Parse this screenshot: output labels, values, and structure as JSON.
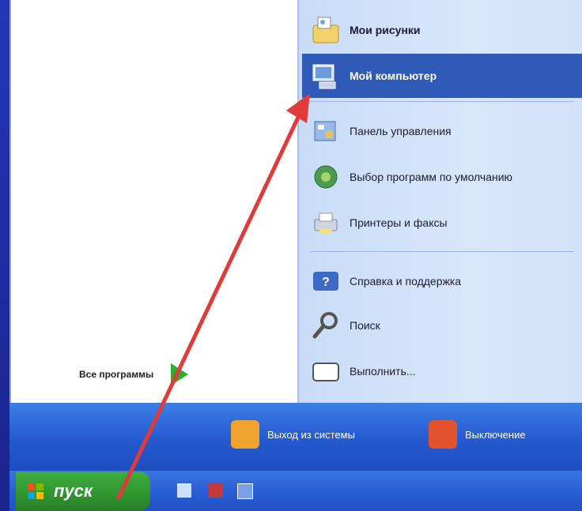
{
  "menu": {
    "right_items": [
      {
        "label": "Мои рисунки",
        "icon": "my-pictures-icon",
        "bold": true
      },
      {
        "label": "Мой компьютер",
        "icon": "my-computer-icon",
        "bold": true,
        "selected": true
      },
      {
        "label": "Панель управления",
        "icon": "control-panel-icon"
      },
      {
        "label": "Выбор программ по умолчанию",
        "icon": "default-programs-icon"
      },
      {
        "label": "Принтеры и факсы",
        "icon": "printers-faxes-icon"
      },
      {
        "label": "Справка и поддержка",
        "icon": "help-support-icon"
      },
      {
        "label": "Поиск",
        "icon": "search-icon"
      },
      {
        "label": "Выполнить...",
        "icon": "run-icon"
      }
    ],
    "all_programs_label": "Все программы"
  },
  "bottom": {
    "logoff_label": "Выход из системы",
    "shutdown_label": "Выключение"
  },
  "taskbar": {
    "start_label": "пуск"
  },
  "colors": {
    "selection": "#2f5ab8",
    "start_green": "#2f942f",
    "taskbar_blue": "#2a5fd4",
    "arrow_red": "#e03a3a"
  }
}
